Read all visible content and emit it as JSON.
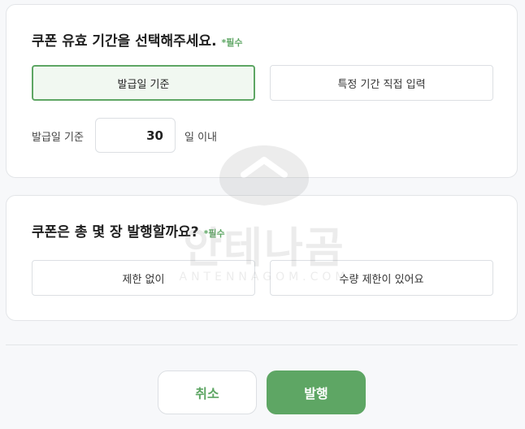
{
  "validity": {
    "title": "쿠폰 유효 기간을 선택해주세요.",
    "required": "*필수",
    "options": [
      {
        "label": "발급일 기준",
        "selected": true
      },
      {
        "label": "특정 기간 직접 입력",
        "selected": false
      }
    ],
    "prefix": "발급일 기준",
    "days_value": "30",
    "suffix": "일 이내"
  },
  "quantity": {
    "title": "쿠폰은 총 몇 장 발행할까요?",
    "required": "*필수",
    "options": [
      {
        "label": "제한 없이",
        "selected": false
      },
      {
        "label": "수량 제한이 있어요",
        "selected": false
      }
    ]
  },
  "actions": {
    "cancel": "취소",
    "issue": "발행"
  },
  "watermark": {
    "text": "안테나곰",
    "sub": "ANTENNAGOM.COM"
  },
  "colors": {
    "accent": "#5ea664",
    "selected_bg": "#f1f8f1",
    "border": "#dcdfe3",
    "page_bg": "#f7f8fa"
  }
}
